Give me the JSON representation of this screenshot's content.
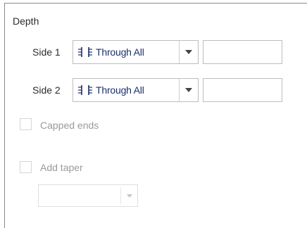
{
  "depth": {
    "title": "Depth",
    "side1": {
      "label": "Side 1",
      "mode": "Through All",
      "value": ""
    },
    "side2": {
      "label": "Side 2",
      "mode": "Through All",
      "value": ""
    }
  },
  "capped_ends": {
    "label": "Capped ends",
    "checked": false,
    "enabled": false
  },
  "add_taper": {
    "label": "Add taper",
    "checked": false,
    "enabled": false,
    "taper_value": ""
  },
  "icons": {
    "through_all": "through-all-icon",
    "dropdown": "chevron-down-icon"
  }
}
